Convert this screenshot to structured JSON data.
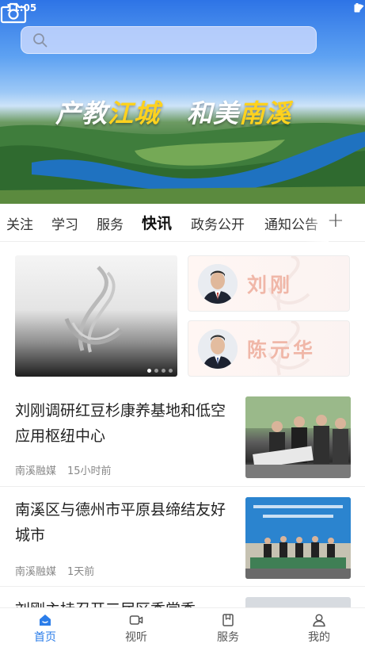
{
  "status_bar": {
    "time": "11:05"
  },
  "search": {
    "placeholder": "",
    "value": ""
  },
  "hero": {
    "slogan_part1": "产教",
    "slogan_part2": "江城",
    "slogan_part3": "和美",
    "slogan_part4": "南溪"
  },
  "tabs": [
    {
      "label": "关注"
    },
    {
      "label": "学习"
    },
    {
      "label": "服务"
    },
    {
      "label": "快讯",
      "active": true
    },
    {
      "label": "政务公开"
    },
    {
      "label": "通知公告"
    }
  ],
  "tab_add_label": "+",
  "leaders": [
    {
      "name": "刘刚"
    },
    {
      "name": "陈元华"
    }
  ],
  "carousel": {
    "page_count": 4,
    "active_index": 0
  },
  "news": [
    {
      "title": "刘刚调研红豆杉康养基地和低空应用枢纽中心",
      "source": "南溪融媒",
      "time": "15小时前"
    },
    {
      "title": "南溪区与德州市平原县缔结友好城市",
      "source": "南溪融媒",
      "time": "1天前"
    },
    {
      "title": "刘刚主持召开三届区委常委",
      "source": "",
      "time": ""
    }
  ],
  "bottom_nav": [
    {
      "label": "首页",
      "icon": "home-icon",
      "active": true
    },
    {
      "label": "视听",
      "icon": "video-icon"
    },
    {
      "label": "服务",
      "icon": "bookmark-icon"
    },
    {
      "label": "我的",
      "icon": "user-icon"
    }
  ],
  "colors": {
    "accent": "#2b7de9",
    "slogan_highlight": "#ffd21e",
    "leader_name": "#f0b7a8"
  }
}
